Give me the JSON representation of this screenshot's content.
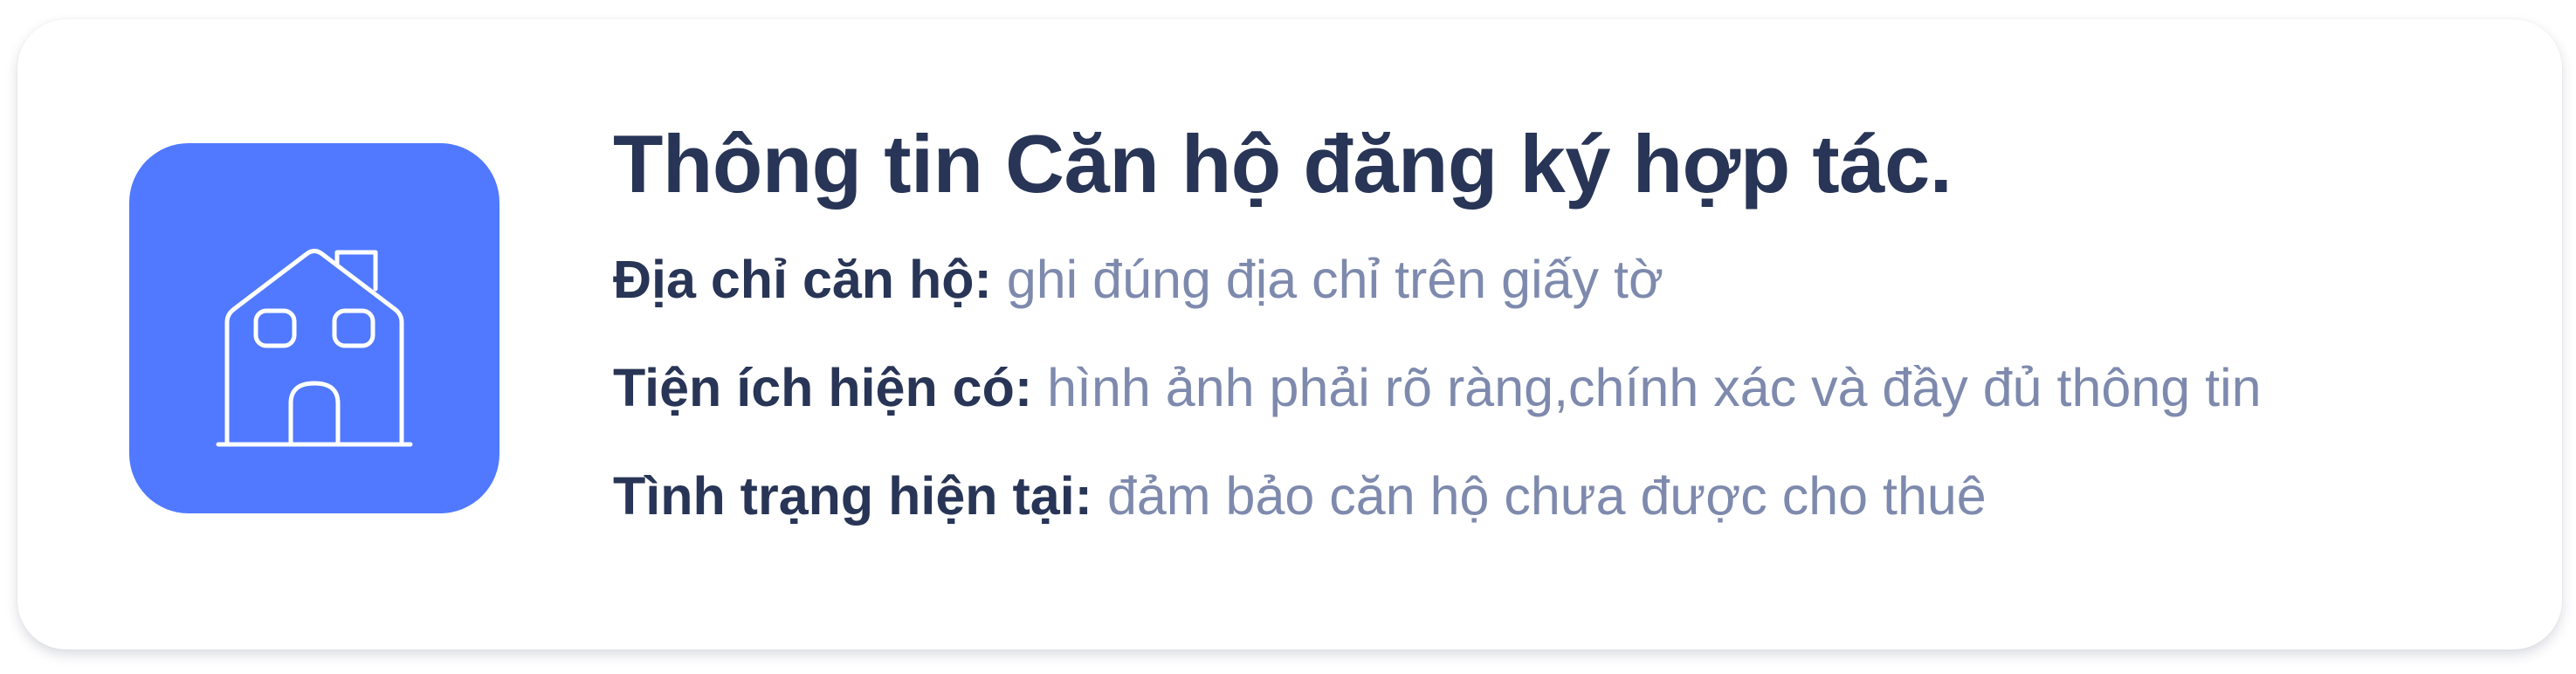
{
  "card": {
    "icon": "house-icon",
    "accent_color": "#5179ff",
    "title": "Thông tin Căn hộ đăng ký hợp tác.",
    "rows": [
      {
        "label": "Địa chỉ căn hộ:",
        "value": "ghi đúng địa chỉ trên giấy tờ"
      },
      {
        "label": "Tiện ích hiện có:",
        "value": "hình ảnh phải rõ ràng,chính xác và đầy đủ thông tin"
      },
      {
        "label": "Tình trạng hiện tại:",
        "value": "đảm bảo căn hộ chưa được cho thuê"
      }
    ]
  }
}
